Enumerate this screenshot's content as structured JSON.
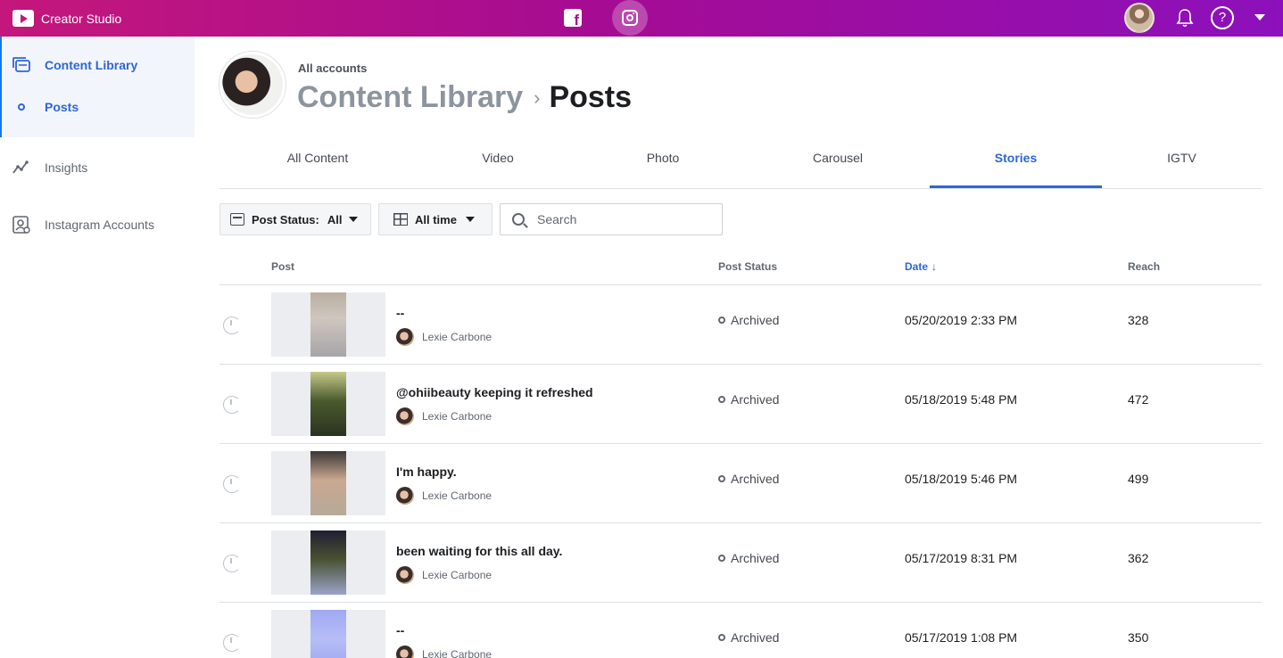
{
  "app": {
    "name": "Creator Studio"
  },
  "topbar": {
    "platforms": [
      {
        "name": "facebook",
        "icon": "facebook-icon",
        "active": false
      },
      {
        "name": "instagram",
        "icon": "instagram-icon",
        "active": true
      }
    ],
    "help_label": "?"
  },
  "sidebar": {
    "items": [
      {
        "label": "Content Library",
        "icon": "content-library-icon",
        "active": true
      },
      {
        "label": "Posts",
        "icon": "dot-icon",
        "active": true
      },
      {
        "label": "Insights",
        "icon": "insights-icon",
        "active": false
      },
      {
        "label": "Instagram Accounts",
        "icon": "accounts-icon",
        "active": false
      }
    ]
  },
  "header": {
    "account_label": "All accounts",
    "breadcrumb_parent": "Content Library",
    "breadcrumb_separator": "›",
    "breadcrumb_current": "Posts"
  },
  "tabs": [
    {
      "label": "All Content",
      "active": false
    },
    {
      "label": "Video",
      "active": false
    },
    {
      "label": "Photo",
      "active": false
    },
    {
      "label": "Carousel",
      "active": false
    },
    {
      "label": "Stories",
      "active": true
    },
    {
      "label": "IGTV",
      "active": false
    }
  ],
  "filters": {
    "status_label": "Post Status:",
    "status_value": "All",
    "time_value": "All time",
    "search_placeholder": "Search"
  },
  "table": {
    "columns": {
      "post": "Post",
      "status": "Post Status",
      "date": "Date",
      "date_sort": "↓",
      "reach": "Reach"
    },
    "rows": [
      {
        "title": "--",
        "author": "Lexie Carbone",
        "status": "Archived",
        "date": "05/20/2019 2:33 PM",
        "reach": "328"
      },
      {
        "title": "@ohiibeauty keeping it refreshed",
        "author": "Lexie Carbone",
        "status": "Archived",
        "date": "05/18/2019 5:48 PM",
        "reach": "472"
      },
      {
        "title": "I'm happy.",
        "author": "Lexie Carbone",
        "status": "Archived",
        "date": "05/18/2019 5:46 PM",
        "reach": "499"
      },
      {
        "title": "been waiting for this all day.",
        "author": "Lexie Carbone",
        "status": "Archived",
        "date": "05/17/2019 8:31 PM",
        "reach": "362"
      },
      {
        "title": "--",
        "author": "Lexie Carbone",
        "status": "Archived",
        "date": "05/17/2019 1:08 PM",
        "reach": "350"
      }
    ]
  },
  "colors": {
    "accent": "#2d66d6",
    "topbar_start": "#c4177b",
    "topbar_end": "#8c10bb"
  }
}
